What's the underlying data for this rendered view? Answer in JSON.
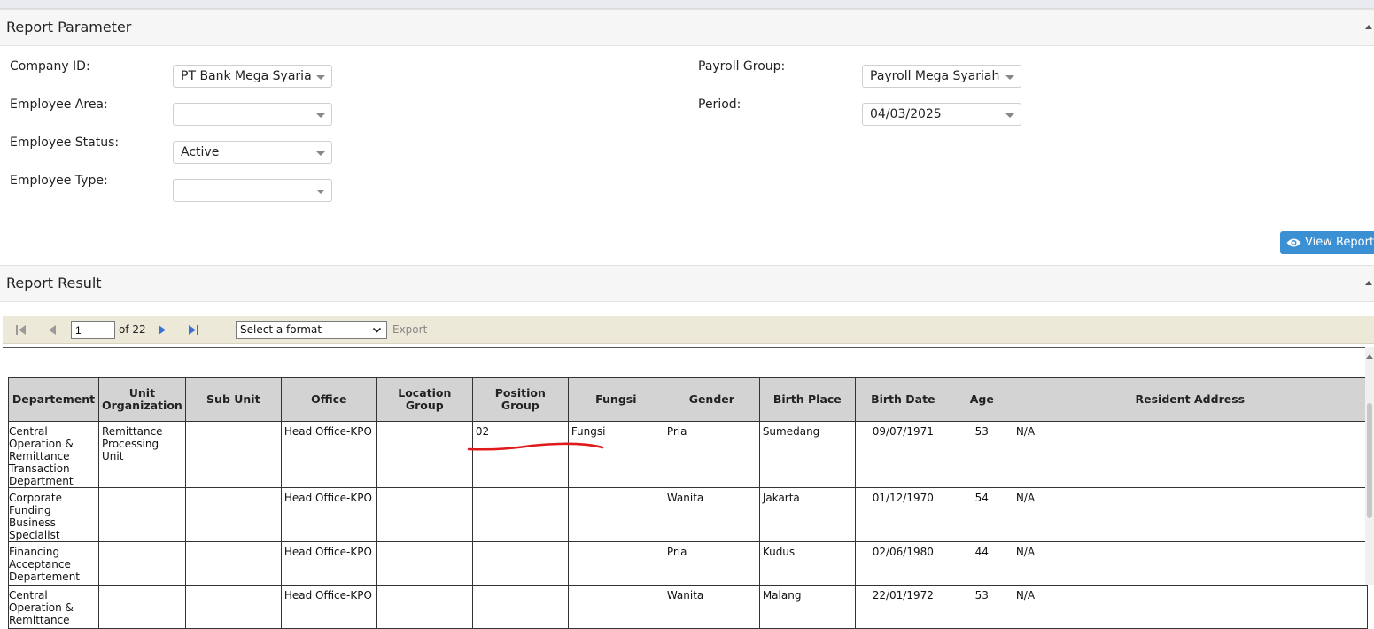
{
  "parameter_panel": {
    "title": "Report Parameter",
    "company_id": {
      "label": "Company ID:",
      "value": "PT Bank Mega Syaria"
    },
    "employee_area": {
      "label": "Employee Area:",
      "value": ""
    },
    "employee_status": {
      "label": "Employee Status:",
      "value": "Active"
    },
    "employee_type": {
      "label": "Employee Type:",
      "value": ""
    },
    "payroll_group": {
      "label": "Payroll Group:",
      "value": "Payroll Mega Syariah"
    },
    "period": {
      "label": "Period:",
      "value": "04/03/2025"
    },
    "view_report_label": "View Report"
  },
  "result_panel": {
    "title": "Report Result"
  },
  "toolbar": {
    "page_value": "1",
    "page_of": "of 22",
    "format_placeholder": "Select a format",
    "export_label": "Export"
  },
  "table": {
    "headers": [
      "Departement",
      "Unit Organization",
      "Sub Unit",
      "Office",
      "Location Group",
      "Position Group",
      "Fungsi",
      "Gender",
      "Birth Place",
      "Birth Date",
      "Age",
      "Resident Address"
    ],
    "rows": [
      [
        "Central Operation & Remittance Transaction Department",
        "Remittance Processing Unit",
        "",
        "Head Office-KPO",
        "",
        "02",
        "Fungsi",
        "Pria",
        "Sumedang",
        "09/07/1971",
        "53",
        "N/A"
      ],
      [
        "Corporate Funding Business Specialist",
        "",
        "",
        "Head Office-KPO",
        "",
        "",
        "",
        "Wanita",
        "Jakarta",
        "01/12/1970",
        "54",
        "N/A"
      ],
      [
        "Financing Acceptance Departement",
        "",
        "",
        "Head Office-KPO",
        "",
        "",
        "",
        "Pria",
        "Kudus",
        "02/06/1980",
        "44",
        "N/A"
      ],
      [
        "Central Operation & Remittance",
        "",
        "",
        "Head Office-KPO",
        "",
        "",
        "",
        "Wanita",
        "Malang",
        "22/01/1972",
        "53",
        "N/A"
      ]
    ]
  },
  "colors": {
    "header_bg": "#d3d3d3",
    "toolbar_bg": "#ece9d8",
    "button_bg": "#3b8fd3",
    "annotation": "#e0191b"
  }
}
